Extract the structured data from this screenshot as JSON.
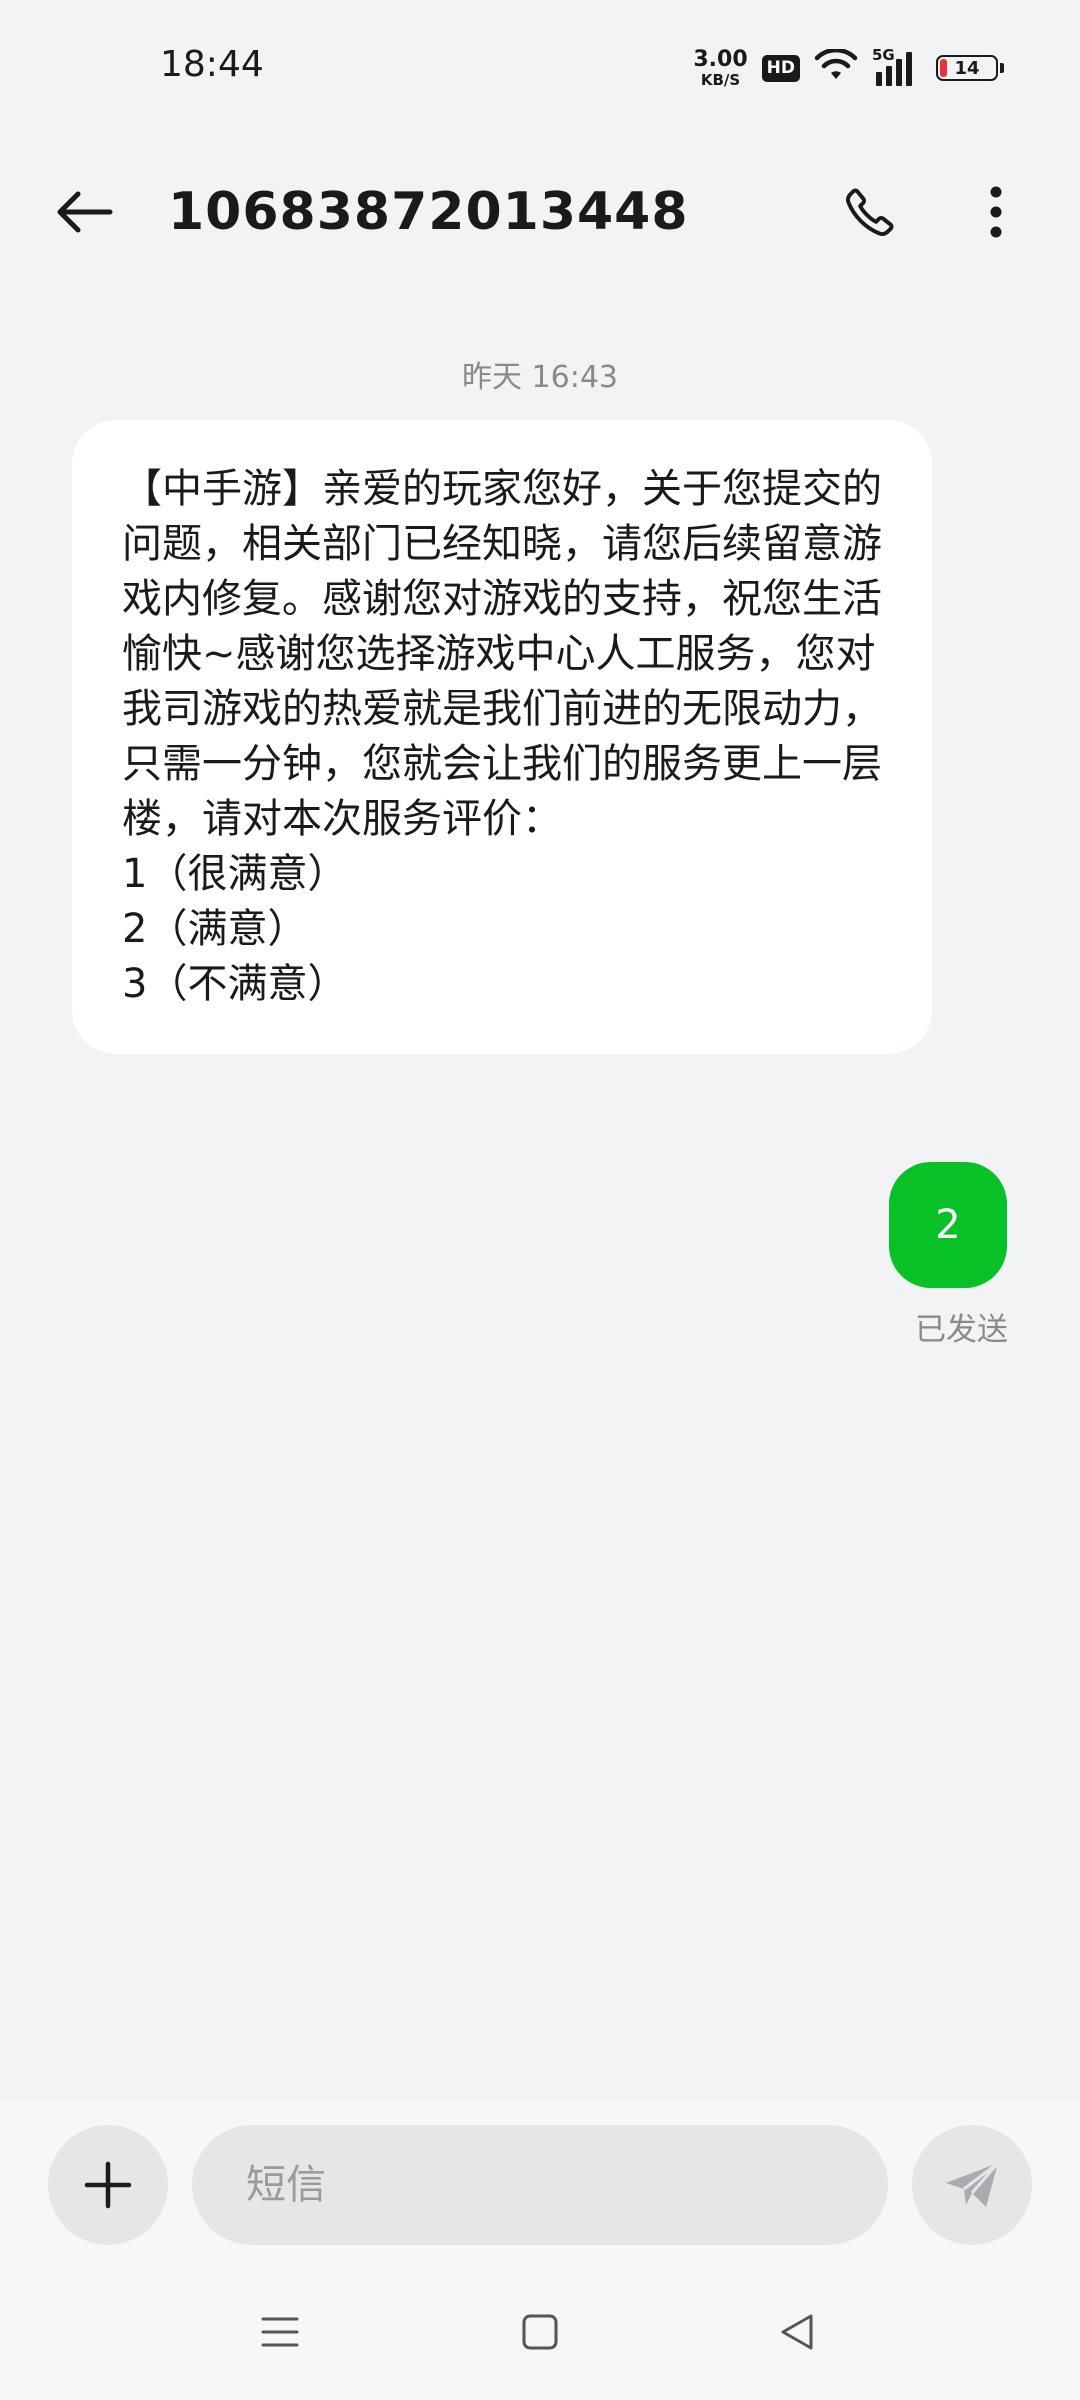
{
  "status_bar": {
    "time": "18:44",
    "net_speed_value": "3.00",
    "net_speed_unit": "KB/S",
    "hd_label": "HD",
    "network_label": "5G",
    "battery_level": "14",
    "battery_fraction": 0.14,
    "battery_color": "#e8333b"
  },
  "header": {
    "title": "10683872013448",
    "back_icon": "arrow-left-icon",
    "call_icon": "phone-icon",
    "more_icon": "more-vertical-icon"
  },
  "conversation": {
    "timestamp": "昨天 16:43",
    "incoming": {
      "text": "【中手游】亲爱的玩家您好，关于您提交的问题，相关部门已经知晓，请您后续留意游戏内修复。感谢您对游戏的支持，祝您生活愉快~感谢您选择游戏中心人工服务，您对我司游戏的热爱就是我们前进的无限动力，只需一分钟，您就会让我们的服务更上一层楼，请对本次服务评价：\n1（很满意）\n2（满意）\n3（不满意）"
    },
    "outgoing": {
      "text": "2",
      "status": "已发送",
      "bubble_color": "#07c126"
    }
  },
  "composer": {
    "placeholder": "短信",
    "value": "",
    "plus_icon": "plus-icon",
    "send_icon": "send-icon"
  },
  "nav_bar": {
    "menu_icon": "menu-icon",
    "home_icon": "home-square-icon",
    "back_icon": "back-triangle-icon"
  }
}
